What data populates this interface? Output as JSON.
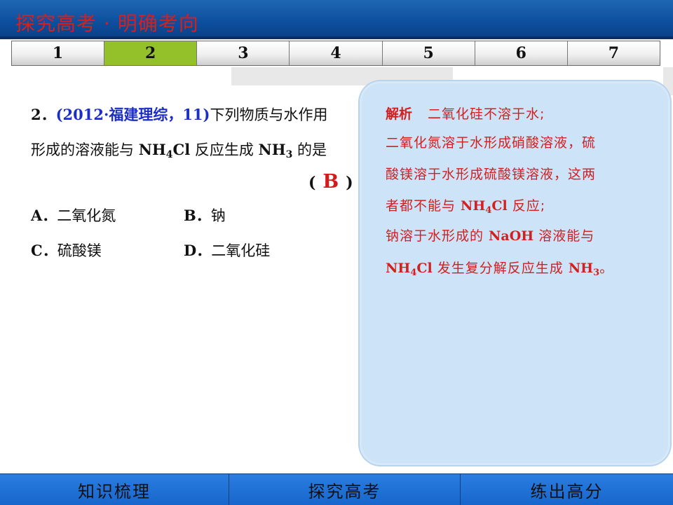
{
  "header": {
    "title": "探究高考 · 明确考向"
  },
  "tabs": [
    {
      "label": "1"
    },
    {
      "label": "2"
    },
    {
      "label": "3"
    },
    {
      "label": "4"
    },
    {
      "label": "5"
    },
    {
      "label": "6"
    },
    {
      "label": "7"
    }
  ],
  "active_tab": "2",
  "question": {
    "number": "2．",
    "source": "(2012·福建理综，11)",
    "text_1": "下列物质与水作用",
    "text_2a": "形成的溶液能与 ",
    "nh4cl_a": "NH",
    "nh4cl_sub": "4",
    "nh4cl_b": "Cl",
    "text_2b": " 反应生成 ",
    "nh3_a": "NH",
    "nh3_sub": "3",
    "text_2c": " 的是",
    "paren_open": "(",
    "answer": "B",
    "paren_close": ")",
    "options": [
      {
        "label": "A．",
        "text": "二氧化氮"
      },
      {
        "label": "B．",
        "text": "钠"
      },
      {
        "label": "C．",
        "text": "硫酸镁"
      },
      {
        "label": "D．",
        "text": "二氧化硅"
      }
    ]
  },
  "explanation": {
    "heading": "解析",
    "line1": "二氧化硅不溶于水;",
    "line2": "二氧化氮溶于水形成硝酸溶液，硫",
    "line3": "酸镁溶于水形成硫酸镁溶液，这两",
    "line4a": "者都不能与 ",
    "line4_nh": "NH",
    "line4_sub": "4",
    "line4_cl": "Cl",
    "line4b": " 反应;",
    "line5a": "钠溶于水形成的 ",
    "line5_naoh": "NaOH",
    "line5b": " 溶液能与",
    "line6_nh": "NH",
    "line6_sub": "4",
    "line6_cl": "Cl",
    "line6b": " 发生复分解反应生成 ",
    "line6_nh3": "NH",
    "line6_sub3": "3",
    "line6c": "。"
  },
  "footer": {
    "items": [
      {
        "label": "知识梳理"
      },
      {
        "label": "探究高考"
      },
      {
        "label": "练出高分"
      }
    ]
  },
  "colors": {
    "active_tab": "#94c12a",
    "header_blue": "#0d4f9e",
    "title_red": "#d61f1f",
    "panel_blue": "#cde3f7",
    "source_blue": "#1d2ec8"
  }
}
